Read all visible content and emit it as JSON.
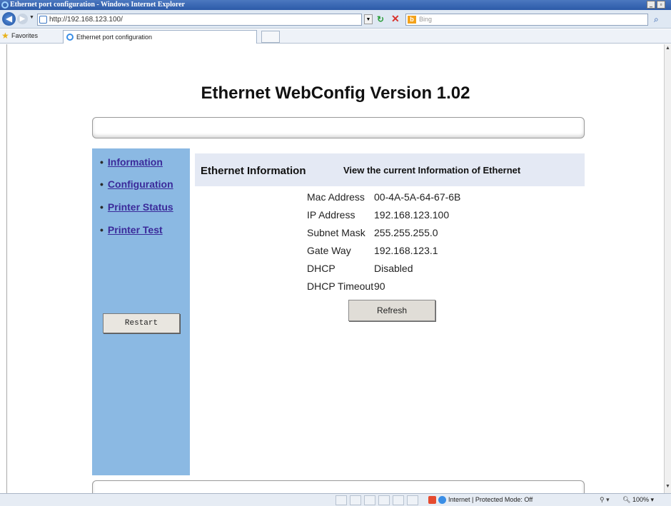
{
  "window": {
    "title": "Ethernet port configuration - Windows Internet Explorer"
  },
  "nav": {
    "url": "http://192.168.123.100/",
    "search_placeholder": "Bing"
  },
  "favorites": {
    "label": "Favorites",
    "tab_title": "Ethernet port configuration"
  },
  "page": {
    "title": "Ethernet WebConfig Version 1.02",
    "sidebar": {
      "links": [
        {
          "label": "Information"
        },
        {
          "label": "Configuration"
        },
        {
          "label": "Printer Status"
        },
        {
          "label": "Printer Test"
        }
      ],
      "restart_label": "Restart"
    },
    "header": {
      "title": "Ethernet Information",
      "subtitle": "View the current Information of Ethernet"
    },
    "info": [
      {
        "label": "Mac Address",
        "value": "00-4A-5A-64-67-6B"
      },
      {
        "label": "IP Address",
        "value": "192.168.123.100"
      },
      {
        "label": "Subnet Mask",
        "value": "255.255.255.0"
      },
      {
        "label": "Gate Way",
        "value": "192.168.123.1"
      },
      {
        "label": "DHCP",
        "value": "Disabled"
      },
      {
        "label": "DHCP Timeout",
        "value": "90"
      }
    ],
    "refresh_label": "Refresh"
  },
  "status": {
    "zone_text": "Internet | Protected Mode: Off",
    "zoom": "100%"
  }
}
